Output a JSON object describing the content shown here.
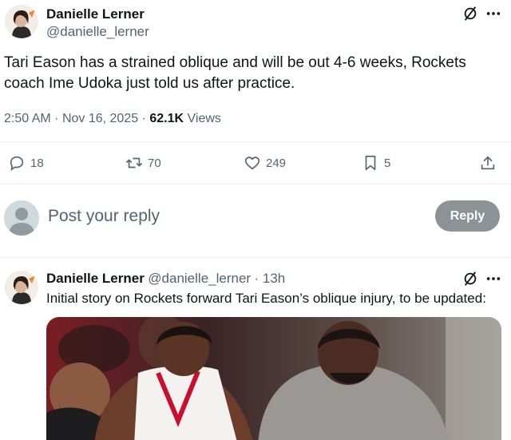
{
  "post": {
    "author_name": "Danielle Lerner",
    "author_handle": "@danielle_lerner",
    "text": "Tari Eason has a strained oblique and will be out 4-6 weeks, Rockets coach Ime Udoka just told us after practice.",
    "time": "2:50 AM",
    "date": "Nov 16, 2025",
    "separator": "·",
    "views_count": "62.1K",
    "views_label": "Views",
    "actions": {
      "replies": "18",
      "reposts": "70",
      "likes": "249",
      "bookmarks": "5"
    }
  },
  "reply_box": {
    "placeholder": "Post your reply",
    "button": "Reply"
  },
  "reply_post": {
    "author_name": "Danielle Lerner",
    "author_handle": "@danielle_lerner",
    "time_ago": "· 13h",
    "text": "Initial story on Rockets forward Tari Eason’s oblique injury, to be updated:"
  },
  "colors": {
    "text": "#0f1419",
    "secondary": "#536471",
    "divider": "#eff3f4",
    "reply_button": "#8c9296"
  },
  "icons": [
    "no-sign-icon",
    "more-icon",
    "reply-icon",
    "repost-icon",
    "like-icon",
    "bookmark-icon",
    "share-icon",
    "user-avatar-icon"
  ]
}
